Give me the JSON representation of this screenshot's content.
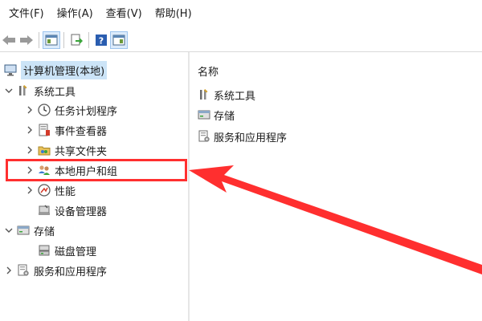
{
  "menu": {
    "file": "文件(F)",
    "action": "操作(A)",
    "view": "查看(V)",
    "help": "帮助(H)"
  },
  "tree": {
    "root": "计算机管理(本地)",
    "system_tools": "系统工具",
    "task_scheduler": "任务计划程序",
    "event_viewer": "事件查看器",
    "shared_folders": "共享文件夹",
    "local_users": "本地用户和组",
    "performance": "性能",
    "device_manager": "设备管理器",
    "storage": "存储",
    "disk_management": "磁盘管理",
    "services_apps": "服务和应用程序"
  },
  "list": {
    "header_name": "名称",
    "items": [
      "系统工具",
      "存储",
      "服务和应用程序"
    ]
  },
  "colors": {
    "annotation_red": "#ff2f2f",
    "selection_blue": "#cce4f7"
  }
}
